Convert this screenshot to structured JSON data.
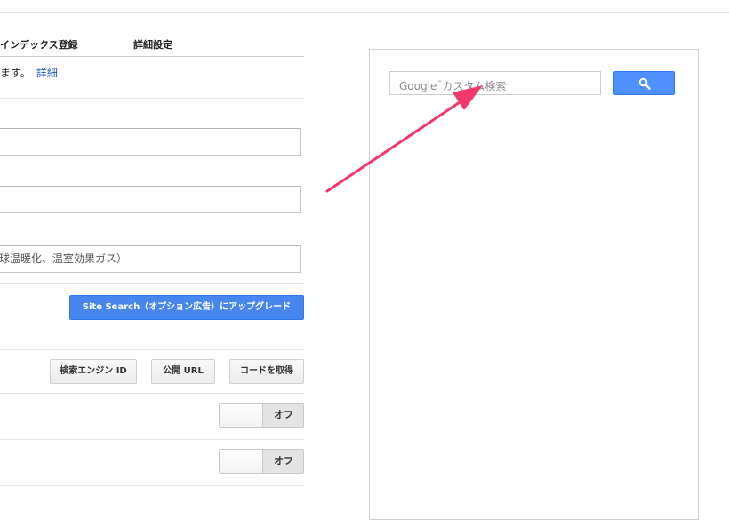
{
  "tabs": [
    {
      "label": "インデックス登録"
    },
    {
      "label": "詳細設定"
    }
  ],
  "description": {
    "text": "ます。",
    "link": "詳細"
  },
  "fields": [
    {
      "value": ""
    },
    {
      "value": ""
    },
    {
      "value": "球温暖化、温室効果ガス）"
    }
  ],
  "upgrade_button": "Site Search（オプション広告）にアップグレード",
  "code_buttons": {
    "engine_id": "検索エンジン ID",
    "public_url": "公開 URL",
    "get_code": "コードを取得"
  },
  "toggles": [
    {
      "state": "オフ"
    },
    {
      "state": "オフ"
    }
  ],
  "preview": {
    "search_placeholder_brand": "Google",
    "search_placeholder_tm": "™",
    "search_placeholder_text": "カスタム検索",
    "search_button_icon": "search-icon"
  },
  "annotation": {
    "arrow_color": "#f2386a"
  },
  "colors": {
    "primary_button": "#4787ed",
    "link": "#1a56c4"
  }
}
